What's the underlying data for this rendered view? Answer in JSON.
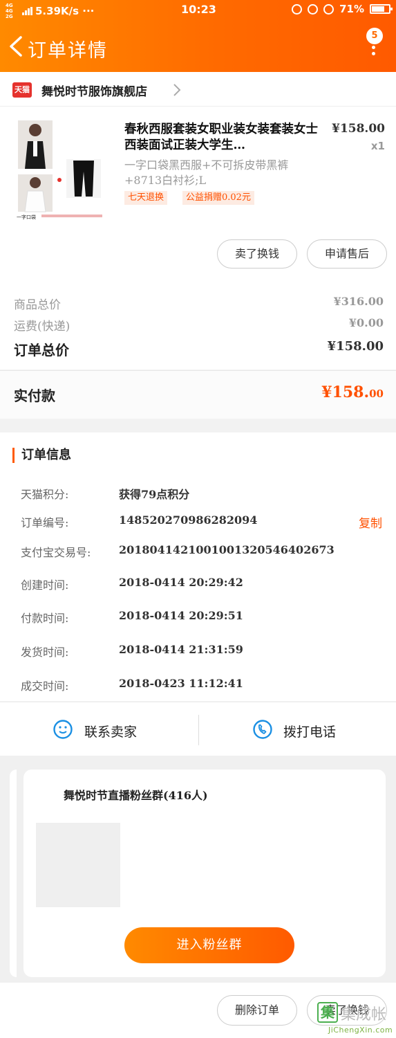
{
  "status_bar": {
    "network": "4G 4G 2G",
    "speed": "5.39K/s ···",
    "time": "10:23",
    "battery": "71%"
  },
  "header": {
    "title": "订单详情",
    "badge_count": "5"
  },
  "shop": {
    "platform": "天猫",
    "name": "舞悦时节服饰旗舰店"
  },
  "product": {
    "title": "春秋西服套装女职业装女装套装女士西装面试正装大学生…",
    "spec": "一字口袋黑西服+不可拆皮带黑裤+8713白衬衫;L",
    "price": "¥158.00",
    "qty": "x1",
    "tags": [
      "七天退换",
      "公益捐赠0.02元"
    ],
    "thumb_caption": "一字口袋"
  },
  "actions": {
    "resell": "卖了换钱",
    "after_sale": "申请售后"
  },
  "totals": {
    "goods_label": "商品总价",
    "goods_value": "¥316.00",
    "shipping_label": "运费(快递)",
    "shipping_value": "¥0.00",
    "order_label": "订单总价",
    "order_value": "¥158.00",
    "paid_label": "实付款",
    "paid_main": "¥158.",
    "paid_cents": "00"
  },
  "order_info": {
    "heading": "订单信息",
    "copy_label": "复制",
    "rows": [
      {
        "label": "天猫积分:",
        "value": "获得79点积分"
      },
      {
        "label": "订单编号:",
        "value": "148520270986282094"
      },
      {
        "label": "支付宝交易号:",
        "value": "2018041421001001320546402673"
      },
      {
        "label": "创建时间:",
        "value": "2018-0414  20:29:42"
      },
      {
        "label": "付款时间:",
        "value": "2018-0414  20:29:51"
      },
      {
        "label": "发货时间:",
        "value": "2018-0414  21:31:59"
      },
      {
        "label": "成交时间:",
        "value": "2018-0423  11:12:41"
      }
    ]
  },
  "contact": {
    "seller": "联系卖家",
    "call": "拨打电话"
  },
  "fan_group": {
    "title": "舞悦时节直播粉丝群(416人)",
    "join": "进入粉丝群"
  },
  "bottom_bar": {
    "delete": "删除订单",
    "resell": "卖了换钱"
  },
  "watermark": {
    "mark": "集",
    "text": "集成帐",
    "url": "JiChengXin.com"
  },
  "colors": {
    "accent": "#ff5a00",
    "header_start": "#ff8a00",
    "tmall_red": "#e5322d",
    "tag_bg": "#fdebe2"
  },
  "icons": [
    "back-arrow-icon",
    "more-dots-icon",
    "chevron-right-icon",
    "chat-face-icon",
    "phone-icon"
  ]
}
